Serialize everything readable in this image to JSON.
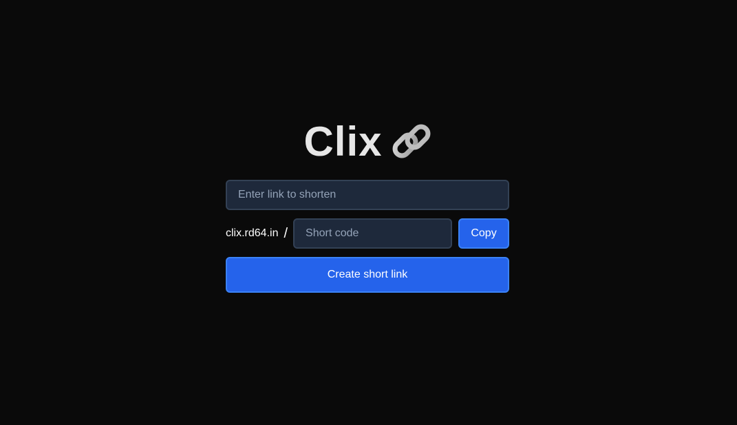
{
  "brand": {
    "title": "Clix",
    "icon": "link-chain-icon"
  },
  "form": {
    "url_input": {
      "value": "",
      "placeholder": "Enter link to shorten"
    },
    "domain": "clix.rd64.in",
    "separator": "/",
    "code_input": {
      "value": "",
      "placeholder": "Short code"
    },
    "copy_label": "Copy",
    "create_label": "Create short link"
  },
  "colors": {
    "background": "#0a0a0a",
    "input_bg": "#1e293b",
    "input_border": "#334155",
    "accent": "#2563eb",
    "accent_border": "#3b82f6"
  }
}
